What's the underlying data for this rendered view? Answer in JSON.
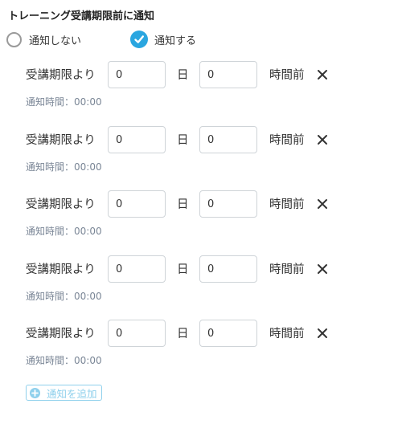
{
  "section": {
    "title": "トレーニング受講期限前に通知"
  },
  "options": {
    "off_label": "通知しない",
    "on_label": "通知する",
    "selected": "通知する"
  },
  "rules": [
    {
      "prefix": "受講期限より",
      "days": "0",
      "day_unit": "日",
      "hours": "0",
      "hours_unit": "時間前",
      "notify_time": "通知時間：00:00"
    },
    {
      "prefix": "受講期限より",
      "days": "0",
      "day_unit": "日",
      "hours": "0",
      "hours_unit": "時間前",
      "notify_time": "通知時間：00:00"
    },
    {
      "prefix": "受講期限より",
      "days": "0",
      "day_unit": "日",
      "hours": "0",
      "hours_unit": "時間前",
      "notify_time": "通知時間：00:00"
    },
    {
      "prefix": "受講期限より",
      "days": "0",
      "day_unit": "日",
      "hours": "0",
      "hours_unit": "時間前",
      "notify_time": "通知時間：00:00"
    },
    {
      "prefix": "受講期限より",
      "days": "0",
      "day_unit": "日",
      "hours": "0",
      "hours_unit": "時間前",
      "notify_time": "通知時間：00:00"
    }
  ],
  "add_button": {
    "label": "通知を追加"
  },
  "icons": {
    "remove": "close-icon",
    "add": "plus-circle-icon",
    "selected": "check-icon"
  },
  "colors": {
    "accent": "#2aa6e0",
    "add_button": "#8fd0ec",
    "muted_text": "#7a8696"
  }
}
